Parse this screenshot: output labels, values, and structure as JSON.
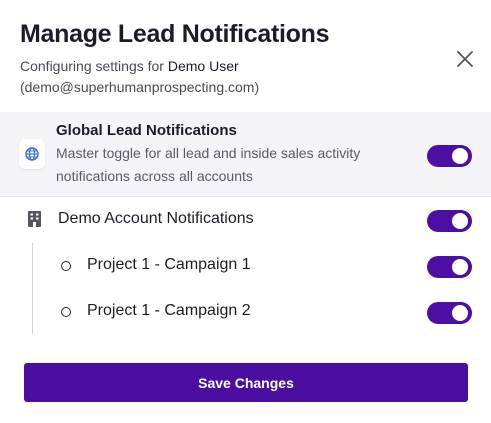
{
  "modal": {
    "title": "Manage Lead Notifications",
    "subtitle_prefix": "Configuring settings for ",
    "user_name": "Demo User",
    "user_email": "(demo@superhumanprospecting.com)"
  },
  "global": {
    "title": "Global Lead Notifications",
    "description": "Master toggle for all lead and inside sales activity notifications across all accounts",
    "enabled": true
  },
  "account": {
    "label": "Demo Account Notifications",
    "enabled": true,
    "campaigns": [
      {
        "label": "Project 1 - Campaign 1",
        "enabled": true
      },
      {
        "label": "Project 1 - Campaign 2",
        "enabled": true
      }
    ]
  },
  "actions": {
    "save_label": "Save Changes"
  },
  "colors": {
    "accent": "#4a0fa0",
    "toggle_on": "#4d0fa3",
    "global_bg": "#f4f4f8",
    "globe_icon": "#3b6fd8"
  }
}
